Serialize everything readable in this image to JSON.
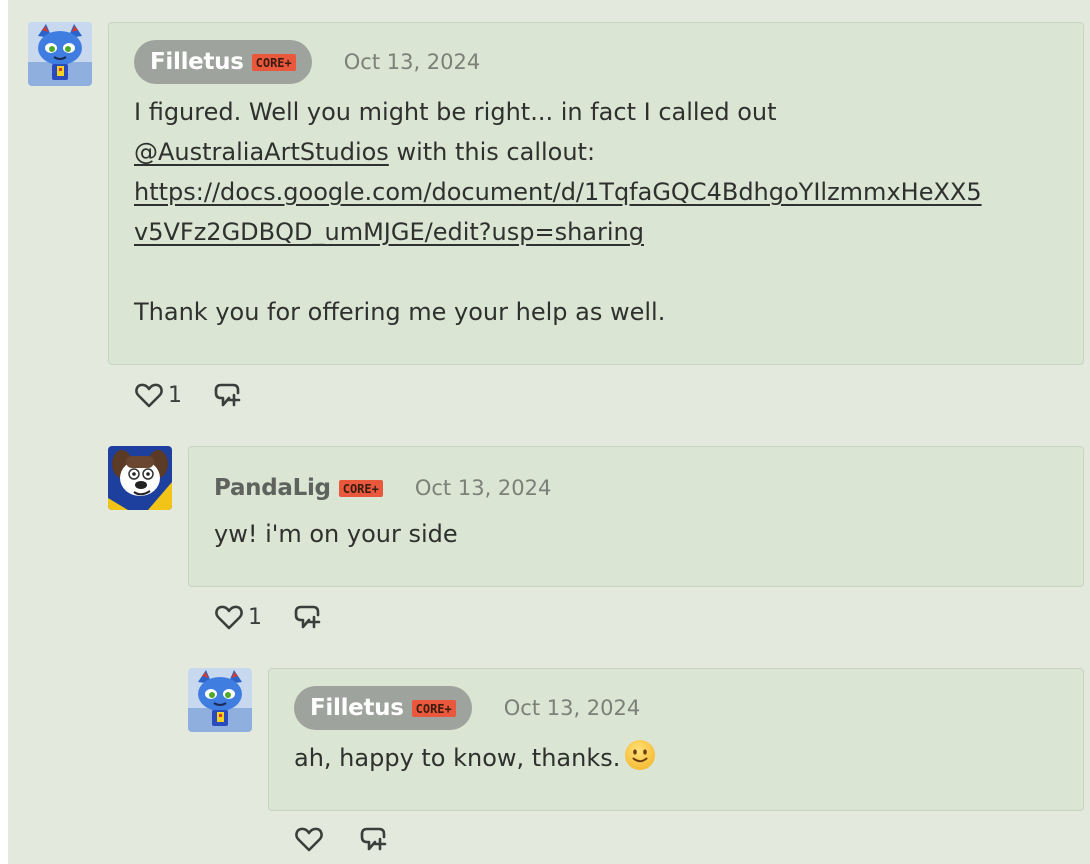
{
  "comments": [
    {
      "username": "Filletus",
      "badge": "CORE+",
      "date": "Oct 13, 2024",
      "line1": "I figured. Well you might be right... in fact I called out",
      "mention": "@AustraliaArtStudios",
      "line2_tail": " with this callout:",
      "link_line1": "https://docs.google.com/document/d/1TqfaGQC4BdhgoYIlzmmxHeXX5",
      "link_line2": "v5VFz2GDBQD_umMJGE/edit?usp=sharing",
      "line_last": "Thank you for offering me your help as well.",
      "likes": "1"
    },
    {
      "username": "PandaLig",
      "badge": "CORE+",
      "date": "Oct 13, 2024",
      "text": "yw! i'm on your side",
      "likes": "1"
    },
    {
      "username": "Filletus",
      "badge": "CORE+",
      "date": "Oct 13, 2024",
      "text": "ah, happy to know, thanks.",
      "likes": ""
    }
  ],
  "icons": {
    "like": "heart-icon",
    "reply": "reply-icon",
    "emoji": "slightly-smiling-face-emoji"
  },
  "colors": {
    "background": "#e4e9dd",
    "bubble": "#dbe5d3",
    "badge": "#e9573d",
    "pill": "#9fa39d"
  }
}
